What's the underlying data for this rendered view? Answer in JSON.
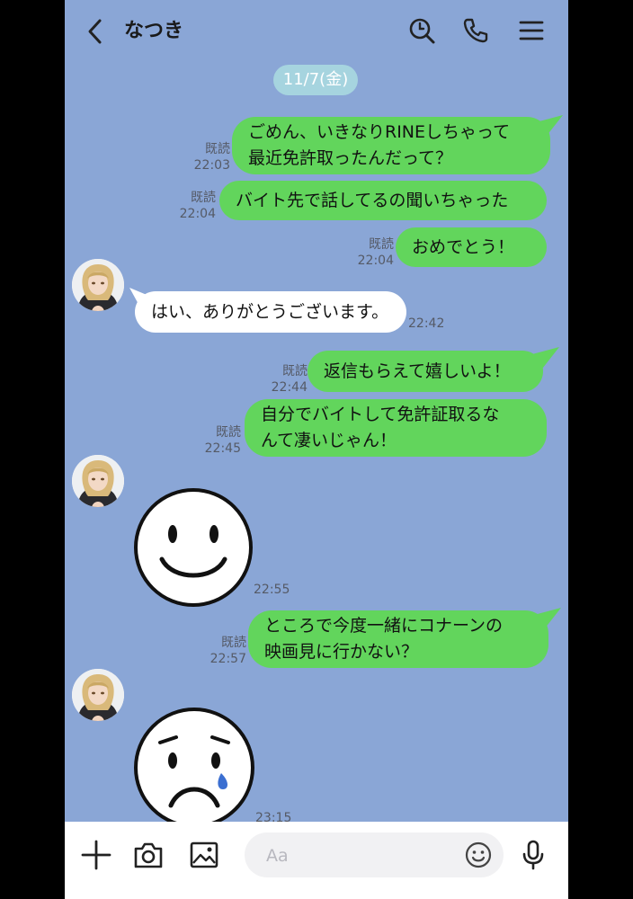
{
  "header": {
    "title": "なつき"
  },
  "date_separator": "11/7(金)",
  "messages": [
    {
      "type": "sent",
      "text": "ごめん、いきなりRINEしちゃって\n最近免許取ったんだって？",
      "read": "既読",
      "time": "22:03"
    },
    {
      "type": "sent",
      "text": "バイト先で話してるの聞いちゃった",
      "read": "既読",
      "time": "22:04"
    },
    {
      "type": "sent",
      "text": "おめでとう！",
      "read": "既読",
      "time": "22:04"
    },
    {
      "type": "received",
      "text": "はい、ありがとうございます。",
      "time": "22:42"
    },
    {
      "type": "sent",
      "text": "返信もらえて嬉しいよ！",
      "read": "既読",
      "time": "22:44"
    },
    {
      "type": "sent",
      "text": "自分でバイトして免許証取るな\nんて凄いじゃん！",
      "read": "既読",
      "time": "22:45"
    },
    {
      "type": "received_sticker",
      "sticker": "smile-face",
      "time": "22:55"
    },
    {
      "type": "sent",
      "text": "ところで今度一緒にコナーンの\n映画見に行かない？",
      "read": "既読",
      "time": "22:57"
    },
    {
      "type": "received_sticker",
      "sticker": "crying-face",
      "time": "23:15"
    }
  ],
  "input": {
    "placeholder": "Aa"
  },
  "icons": [
    "back-icon",
    "search-icon",
    "phone-icon",
    "menu-icon",
    "plus-icon",
    "camera-icon",
    "image-icon",
    "emoji-icon",
    "mic-icon"
  ],
  "colors": {
    "background": "#8aa6d6",
    "sent_bubble": "#62d55c",
    "received_bubble": "#ffffff",
    "date_pill": "#a6d4df"
  }
}
